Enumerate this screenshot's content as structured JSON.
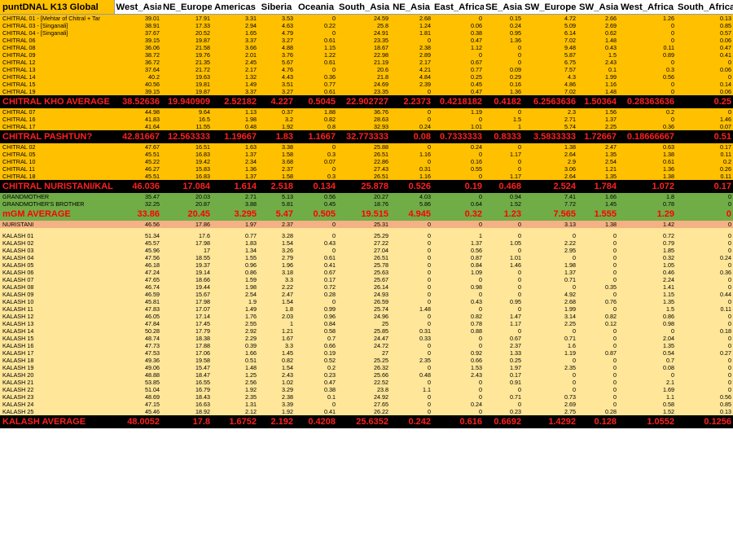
{
  "header": [
    "puntDNAL K13 Global",
    "West_Asia",
    "NE_Europe",
    "Americas",
    "Siberia",
    "Oceania",
    "South_Asia",
    "NE_Asia",
    "East_Africa",
    "SE_Asia",
    "SW_Europe",
    "SW_Asia",
    "West_Africa",
    "South_Africa"
  ],
  "rows": [
    {
      "style": "orange",
      "cells": [
        "CHITRAL 01 - [Mehtar of Chitral + Tar",
        "39.01",
        "17.91",
        "3.31",
        "3.53",
        "0",
        "24.59",
        "2.68",
        "0",
        "0.15",
        "4.72",
        "2.66",
        "1.26",
        "0.13"
      ]
    },
    {
      "style": "orange",
      "cells": [
        "CHITRAL 03 - [Singanali]",
        "38.91",
        "17.33",
        "2.94",
        "4.63",
        "0.22",
        "25.8",
        "1.24",
        "0.06",
        "0.24",
        "5.09",
        "2.69",
        "0",
        "0.85"
      ]
    },
    {
      "style": "orange",
      "cells": [
        "CHITRAL 04 - [Singanali]",
        "37.67",
        "20.52",
        "1.65",
        "4.79",
        "0",
        "24.91",
        "1.81",
        "0.38",
        "0.95",
        "6.14",
        "0.62",
        "0",
        "0.57"
      ]
    },
    {
      "style": "orange",
      "cells": [
        "CHITRAL 06",
        "39.15",
        "19.87",
        "3.37",
        "3.27",
        "0.61",
        "23.35",
        "0",
        "0.47",
        "1.36",
        "7.02",
        "1.48",
        "0",
        "0.06"
      ]
    },
    {
      "style": "orange",
      "cells": [
        "CHITRAL 08",
        "36.06",
        "21.58",
        "3.66",
        "4.88",
        "1.15",
        "18.67",
        "2.38",
        "1.12",
        "0",
        "9.48",
        "0.43",
        "0.11",
        "0.47"
      ]
    },
    {
      "style": "orange",
      "cells": [
        "CHITRAL 09",
        "38.72",
        "19.76",
        "2.01",
        "3.76",
        "1.22",
        "22.98",
        "2.89",
        "0",
        "0",
        "5.87",
        "1.5",
        "0.89",
        "0.41"
      ]
    },
    {
      "style": "orange",
      "cells": [
        "CHITRAL 12",
        "36.72",
        "21.35",
        "2.45",
        "5.67",
        "0.61",
        "21.19",
        "2.17",
        "0.67",
        "0",
        "6.75",
        "2.43",
        "0",
        "0"
      ]
    },
    {
      "style": "orange",
      "cells": [
        "CHITRAL 13",
        "37.64",
        "21.72",
        "2.17",
        "4.76",
        "0",
        "20.6",
        "4.21",
        "0.77",
        "0.09",
        "7.57",
        "0.1",
        "0.3",
        "0.06"
      ]
    },
    {
      "style": "orange",
      "cells": [
        "CHITRAL 14",
        "40.2",
        "19.63",
        "1.32",
        "4.43",
        "0.36",
        "21.8",
        "4.84",
        "0.25",
        "0.29",
        "4.3",
        "1.99",
        "0.56",
        "0"
      ]
    },
    {
      "style": "orange",
      "cells": [
        "CHITRAL 15",
        "40.56",
        "19.81",
        "1.49",
        "3.51",
        "0.77",
        "24.69",
        "2.39",
        "0.45",
        "0.16",
        "4.86",
        "1.16",
        "0",
        "0.14"
      ]
    },
    {
      "style": "orange",
      "cells": [
        "CHITRAL 19",
        "39.15",
        "19.87",
        "3.37",
        "3.27",
        "0.61",
        "23.35",
        "0",
        "0.47",
        "1.36",
        "7.02",
        "1.48",
        "0",
        "0.06"
      ]
    },
    {
      "style": "avg",
      "cells": [
        "CHITRAL KHO AVERAGE",
        "38.52636",
        "19.940909",
        "2.52182",
        "4.227",
        "0.5045",
        "22.902727",
        "2.2373",
        "0.4218182",
        "0.4182",
        "6.2563636",
        "1.50364",
        "0.28363636",
        "0.25"
      ]
    },
    {
      "style": "orange",
      "cells": [
        "CHITRAL 07",
        "44.98",
        "9.64",
        "1.13",
        "0.37",
        "1.88",
        "36.76",
        "0",
        "1.19",
        "0",
        "2.3",
        "1.56",
        "0.2",
        "0"
      ]
    },
    {
      "style": "orange",
      "cells": [
        "CHITRAL 16",
        "41.83",
        "16.5",
        "1.98",
        "3.2",
        "0.82",
        "28.63",
        "0",
        "0",
        "1.5",
        "2.71",
        "1.37",
        "0",
        "1.46"
      ]
    },
    {
      "style": "orange",
      "cells": [
        "CHITRAL 17",
        "41.64",
        "11.55",
        "0.48",
        "1.92",
        "0.8",
        "32.93",
        "0.24",
        "1.01",
        "1",
        "5.74",
        "2.25",
        "0.36",
        "0.07"
      ]
    },
    {
      "style": "avg",
      "cells": [
        "CHITRAL PASHTUN?",
        "42.81667",
        "12.563333",
        "1.19667",
        "1.83",
        "1.1667",
        "32.773333",
        "0.08",
        "0.7333333",
        "0.8333",
        "3.5833333",
        "1.72667",
        "0.18666667",
        "0.51"
      ]
    },
    {
      "style": "orange",
      "cells": [
        "CHITRAL 02",
        "47.67",
        "16.51",
        "1.63",
        "3.38",
        "0",
        "25.88",
        "0",
        "0.24",
        "0",
        "1.38",
        "2.47",
        "0.63",
        "0.17"
      ]
    },
    {
      "style": "orange",
      "cells": [
        "CHITRAL 05",
        "45.51",
        "16.83",
        "1.37",
        "1.58",
        "0.3",
        "26.51",
        "1.16",
        "0",
        "1.17",
        "2.64",
        "1.35",
        "1.38",
        "0.11"
      ]
    },
    {
      "style": "orange",
      "cells": [
        "CHITRAL 10",
        "45.22",
        "19.42",
        "2.34",
        "3.68",
        "0.07",
        "22.86",
        "0",
        "0.16",
        "0",
        "2.9",
        "2.54",
        "0.61",
        "0.2"
      ]
    },
    {
      "style": "orange",
      "cells": [
        "CHITRAL 11",
        "46.27",
        "15.83",
        "1.36",
        "2.37",
        "0",
        "27.43",
        "0.31",
        "0.55",
        "0",
        "3.06",
        "1.21",
        "1.36",
        "0.26"
      ]
    },
    {
      "style": "orange",
      "cells": [
        "CHITRAL 18",
        "45.51",
        "16.83",
        "1.37",
        "1.58",
        "0.3",
        "26.51",
        "1.16",
        "0",
        "1.17",
        "2.64",
        "1.35",
        "1.38",
        "0.11"
      ]
    },
    {
      "style": "avg",
      "cells": [
        "CHITRAL NURISTANI/KAL",
        "46.036",
        "17.084",
        "1.614",
        "2.518",
        "0.134",
        "25.878",
        "0.526",
        "0.19",
        "0.468",
        "2.524",
        "1.784",
        "1.072",
        "0.17"
      ]
    },
    {
      "style": "green",
      "cells": [
        "GRANDMOTHER",
        "35.47",
        "20.03",
        "2.71",
        "5.13",
        "0.56",
        "20.27",
        "4.03",
        "0",
        "0.94",
        "7.41",
        "1.66",
        "1.8",
        "0"
      ]
    },
    {
      "style": "green",
      "cells": [
        "GRANDMOTHER'S BROTHER",
        "32.25",
        "20.87",
        "3.88",
        "5.81",
        "0.45",
        "18.76",
        "5.86",
        "0.64",
        "1.52",
        "7.72",
        "1.45",
        "0.78",
        "0"
      ]
    },
    {
      "style": "avg mgm",
      "cells": [
        "mGM AVERAGE",
        "33.86",
        "20.45",
        "3.295",
        "5.47",
        "0.505",
        "19.515",
        "4.945",
        "0.32",
        "1.23",
        "7.565",
        "1.555",
        "1.29",
        "0"
      ]
    },
    {
      "style": "salmon",
      "cells": [
        "NURISTANI",
        "46.56",
        "17.86",
        "1.97",
        "2.37",
        "0",
        "25.31",
        "0",
        "0",
        "0",
        "3.13",
        "1.38",
        "1.42",
        "0"
      ]
    },
    {
      "style": "spacer",
      "cells": [
        "",
        "",
        "",
        "",
        "",
        "",
        "",
        "",
        "",
        "",
        "",
        "",
        "",
        ""
      ]
    },
    {
      "style": "cream",
      "cells": [
        "KALASH 01",
        "51.34",
        "17.6",
        "0.77",
        "3.28",
        "0",
        "25.29",
        "0",
        "1",
        "0",
        "0",
        "0",
        "0.72",
        "0"
      ]
    },
    {
      "style": "cream",
      "cells": [
        "KALASH 02",
        "45.57",
        "17.98",
        "1.83",
        "1.54",
        "0.43",
        "27.22",
        "0",
        "1.37",
        "1.05",
        "2.22",
        "0",
        "0.79",
        "0"
      ]
    },
    {
      "style": "cream",
      "cells": [
        "KALASH 03",
        "45.96",
        "17",
        "1.34",
        "3.26",
        "0",
        "27.04",
        "0",
        "0.56",
        "0",
        "2.95",
        "0",
        "1.85",
        "0"
      ]
    },
    {
      "style": "cream",
      "cells": [
        "KALASH 04",
        "47.56",
        "18.55",
        "1.55",
        "2.79",
        "0.61",
        "26.51",
        "0",
        "0.87",
        "1.01",
        "0",
        "0",
        "0.32",
        "0.24"
      ]
    },
    {
      "style": "cream",
      "cells": [
        "KALASH 05",
        "46.18",
        "19.37",
        "0.96",
        "1.96",
        "0.41",
        "25.78",
        "0",
        "0.84",
        "1.46",
        "1.98",
        "0",
        "1.05",
        "0"
      ]
    },
    {
      "style": "cream",
      "cells": [
        "KALASH 06",
        "47.24",
        "19.14",
        "0.86",
        "3.18",
        "0.67",
        "25.63",
        "0",
        "1.09",
        "0",
        "1.37",
        "0",
        "0.46",
        "0.36"
      ]
    },
    {
      "style": "cream",
      "cells": [
        "KALASH 07",
        "47.65",
        "18.66",
        "1.59",
        "3.3",
        "0.17",
        "25.67",
        "0",
        "0",
        "0",
        "0.71",
        "0",
        "2.24",
        "0"
      ]
    },
    {
      "style": "cream",
      "cells": [
        "KALASH 08",
        "46.74",
        "19.44",
        "1.98",
        "2.22",
        "0.72",
        "26.14",
        "0",
        "0.98",
        "0",
        "0",
        "0.35",
        "1.41",
        "0"
      ]
    },
    {
      "style": "cream",
      "cells": [
        "KALASH 09",
        "46.59",
        "15.67",
        "2.54",
        "2.47",
        "0.28",
        "24.93",
        "0",
        "0",
        "0",
        "4.92",
        "0",
        "1.15",
        "0.44"
      ]
    },
    {
      "style": "cream",
      "cells": [
        "KALASH 10",
        "45.81",
        "17.98",
        "1.9",
        "1.54",
        "0",
        "26.59",
        "0",
        "0.43",
        "0.95",
        "2.68",
        "0.76",
        "1.35",
        "0"
      ]
    },
    {
      "style": "cream",
      "cells": [
        "KALASH 11",
        "47.83",
        "17.07",
        "1.49",
        "1.8",
        "0.99",
        "25.74",
        "1.48",
        "0",
        "0",
        "1.99",
        "0",
        "1.5",
        "0.11"
      ]
    },
    {
      "style": "cream",
      "cells": [
        "KALASH 12",
        "46.05",
        "17.14",
        "1.76",
        "2.03",
        "0.96",
        "24.96",
        "0",
        "0.82",
        "1.47",
        "3.14",
        "0.82",
        "0.86",
        "0"
      ]
    },
    {
      "style": "cream",
      "cells": [
        "KALASH 13",
        "47.84",
        "17.45",
        "2.55",
        "1",
        "0.84",
        "25",
        "0",
        "0.78",
        "1.17",
        "2.25",
        "0.12",
        "0.98",
        "0"
      ]
    },
    {
      "style": "cream",
      "cells": [
        "KALASH 14",
        "50.28",
        "17.79",
        "2.92",
        "1.21",
        "0.58",
        "25.85",
        "0.31",
        "0.88",
        "0",
        "0",
        "0",
        "0",
        "0.18"
      ]
    },
    {
      "style": "cream",
      "cells": [
        "KALASH 15",
        "48.74",
        "18.38",
        "2.29",
        "1.67",
        "0.7",
        "24.47",
        "0.33",
        "0",
        "0.67",
        "0.71",
        "0",
        "2.04",
        "0"
      ]
    },
    {
      "style": "cream",
      "cells": [
        "KALASH 16",
        "47.73",
        "17.88",
        "0.39",
        "3.3",
        "0.66",
        "24.72",
        "0",
        "0",
        "2.37",
        "1.6",
        "0",
        "1.35",
        "0"
      ]
    },
    {
      "style": "cream",
      "cells": [
        "KALASH 17",
        "47.53",
        "17.06",
        "1.66",
        "1.45",
        "0.19",
        "27",
        "0",
        "0.92",
        "1.33",
        "1.19",
        "0.87",
        "0.54",
        "0.27"
      ]
    },
    {
      "style": "cream",
      "cells": [
        "KALASH 18",
        "49.36",
        "19.58",
        "0.51",
        "0.82",
        "0.52",
        "25.25",
        "2.35",
        "0.66",
        "0.25",
        "0",
        "0",
        "0.7",
        "0"
      ]
    },
    {
      "style": "cream",
      "cells": [
        "KALASH 19",
        "49.06",
        "15.47",
        "1.48",
        "1.54",
        "0.2",
        "26.32",
        "0",
        "1.53",
        "1.97",
        "2.35",
        "0",
        "0.08",
        "0"
      ]
    },
    {
      "style": "cream",
      "cells": [
        "KALASH 20",
        "48.88",
        "18.47",
        "1.25",
        "2.43",
        "0.23",
        "25.66",
        "0.48",
        "2.43",
        "0.17",
        "0",
        "0",
        "0",
        "0"
      ]
    },
    {
      "style": "cream",
      "cells": [
        "KALASH 21",
        "53.85",
        "16.55",
        "2.56",
        "1.02",
        "0.47",
        "22.52",
        "0",
        "0",
        "0.91",
        "0",
        "0",
        "2.1",
        "0"
      ]
    },
    {
      "style": "cream",
      "cells": [
        "KALASH 22",
        "51.04",
        "16.79",
        "1.92",
        "3.29",
        "0.38",
        "23.8",
        "1.1",
        "0",
        "0",
        "0",
        "0",
        "1.69",
        "0"
      ]
    },
    {
      "style": "cream",
      "cells": [
        "KALASH 23",
        "48.69",
        "18.43",
        "2.35",
        "2.38",
        "0.1",
        "24.92",
        "0",
        "0",
        "0.71",
        "0.73",
        "0",
        "1.1",
        "0.56"
      ]
    },
    {
      "style": "cream",
      "cells": [
        "KALASH 24",
        "47.15",
        "16.63",
        "1.31",
        "3.39",
        "0",
        "27.65",
        "0",
        "0.24",
        "0",
        "2.69",
        "0",
        "0.58",
        "0.85"
      ]
    },
    {
      "style": "cream",
      "cells": [
        "KALASH 25",
        "45.46",
        "18.92",
        "2.12",
        "1.92",
        "0.41",
        "26.22",
        "0",
        "0",
        "0.23",
        "2.75",
        "0.28",
        "1.52",
        "0.13"
      ]
    },
    {
      "style": "avg",
      "cells": [
        "KALASH AVERAGE",
        "48.0052",
        "17.8",
        "1.6752",
        "2.192",
        "0.4208",
        "25.6352",
        "0.242",
        "0.616",
        "0.6692",
        "1.4292",
        "0.128",
        "1.0552",
        "0.1256"
      ]
    }
  ]
}
